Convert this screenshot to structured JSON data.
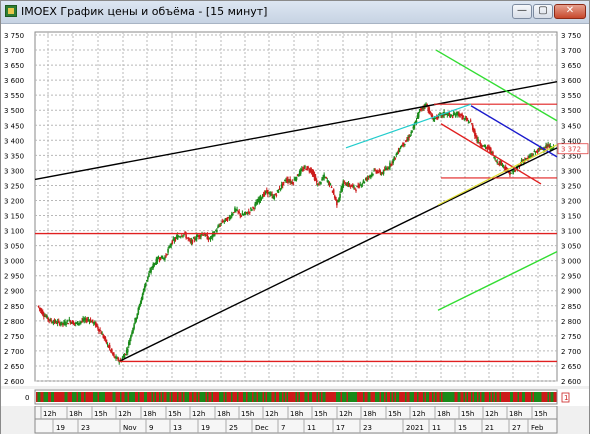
{
  "window": {
    "title": "IMOEX График цены и объёма - [15 минут]",
    "min_symbol": "—",
    "max_symbol": "▢",
    "close_symbol": "✕"
  },
  "volume_panel": {
    "left_label": "0",
    "right_label": "1"
  },
  "colors": {
    "up": "#1a8a1a",
    "down": "#cc1a1a",
    "red_line": "#e02020",
    "black_line": "#000000",
    "green_line": "#33dd33",
    "cyan_line": "#22cccc",
    "blue_line": "#1a1acc",
    "yellow_line": "#dddd33",
    "current_price": "#e04040"
  },
  "chart_data": {
    "type": "candlestick",
    "ylim": [
      2600,
      3760
    ],
    "y_ticks": [
      "3 750",
      "3 700",
      "3 650",
      "3 600",
      "3 550",
      "3 500",
      "3 450",
      "3 400",
      "3 350",
      "3 300",
      "3 250",
      "3 200",
      "3 150",
      "3 100",
      "3 050",
      "3 000",
      "2 950",
      "2 900",
      "2 850",
      "2 800",
      "2 750",
      "2 700",
      "2 650",
      "2 600"
    ],
    "current_price_label": "3 372",
    "time_labels_top": [
      "12h",
      "18h",
      "15h",
      "12h",
      "18h",
      "15h",
      "12h",
      "18h",
      "15h",
      "12h",
      "18h",
      "15h",
      "12h",
      "18h",
      "15h",
      "12h",
      "18h",
      "15h",
      "12h",
      "18h",
      "15h"
    ],
    "time_labels_bottom": [
      "19",
      "23",
      "Nov",
      "9",
      "13",
      "19",
      "25",
      "Dec",
      "7",
      "11",
      "17",
      "23",
      "2021",
      "11",
      "15",
      "21",
      "27",
      "Feb"
    ],
    "price_path": [
      2850,
      2820,
      2800,
      2795,
      2790,
      2800,
      2790,
      2800,
      2805,
      2790,
      2760,
      2720,
      2680,
      2665,
      2700,
      2780,
      2850,
      2930,
      2980,
      3010,
      3010,
      3060,
      3080,
      3090,
      3060,
      3080,
      3090,
      3070,
      3100,
      3130,
      3140,
      3170,
      3150,
      3160,
      3180,
      3210,
      3230,
      3210,
      3240,
      3270,
      3260,
      3290,
      3310,
      3300,
      3250,
      3280,
      3250,
      3190,
      3260,
      3250,
      3240,
      3260,
      3280,
      3300,
      3290,
      3310,
      3340,
      3380,
      3400,
      3440,
      3500,
      3520,
      3470,
      3480,
      3490,
      3480,
      3490,
      3470,
      3460,
      3400,
      3380,
      3370,
      3330,
      3320,
      3290,
      3300,
      3330,
      3340,
      3360,
      3372,
      3380,
      3372
    ]
  }
}
